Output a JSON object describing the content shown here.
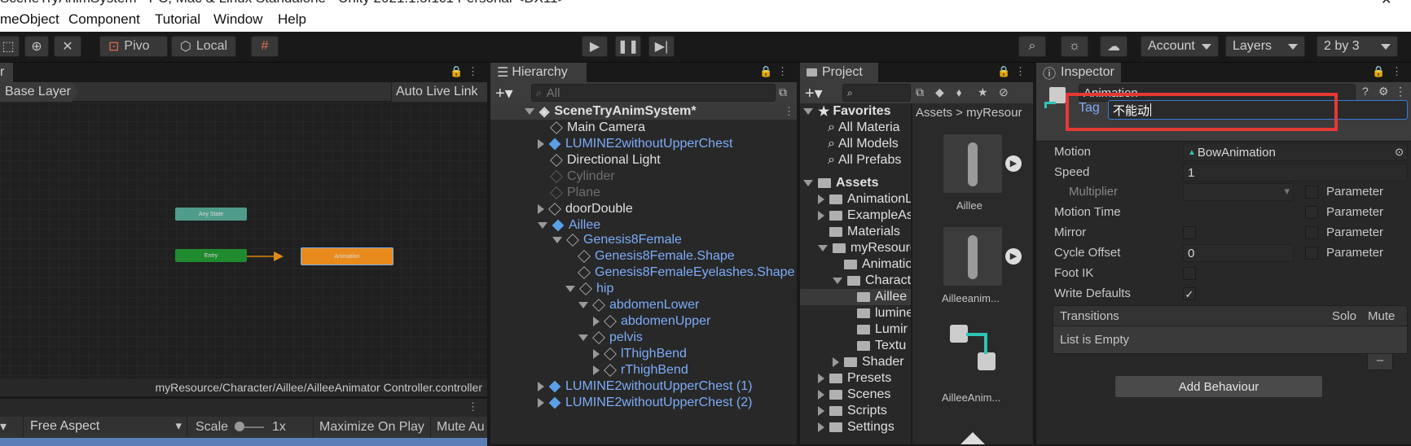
{
  "window": {
    "title": "SceneTryAnimSystem - PC, Mac & Linux Standalone - Unity 2021.1.5f1c1 Personal <DX11>"
  },
  "menu": [
    "meObject",
    "Component",
    "Tutorial",
    "Window",
    "Help"
  ],
  "toolbar": {
    "pivot_label": "Pivo",
    "local_label": "Local",
    "account_label": "Account",
    "layers_label": "Layers",
    "layout_label": "2 by 3"
  },
  "animator": {
    "breadcrumb": "Base Layer",
    "auto_live_link": "Auto Live Link",
    "path": "myResource/Character/Aillee/AilleeAnimator Controller.controller",
    "nodes": {
      "any_state": "Any State",
      "entry": "Entry",
      "animation": "Animation"
    }
  },
  "game": {
    "aspect": "Free Aspect",
    "scale_label": "Scale",
    "scale_value": "1x",
    "maximize": "Maximize On Play",
    "mute": "Mute Au"
  },
  "hierarchy": {
    "tab": "Hierarchy",
    "search_placeholder": "All",
    "scene": "SceneTryAnimSystem*",
    "items": [
      "Main Camera",
      "LUMINE2withoutUpperChest",
      "Directional Light",
      "Cylinder",
      "Plane",
      "doorDouble",
      "Aillee",
      "Genesis8Female",
      "Genesis8Female.Shape",
      "Genesis8FemaleEyelashes.Shape",
      "hip",
      "abdomenLower",
      "abdomenUpper",
      "pelvis",
      "lThighBend",
      "rThighBend",
      "LUMINE2withoutUpperChest (1)",
      "LUMINE2withoutUpperChest (2)"
    ]
  },
  "project": {
    "tab": "Project",
    "favorites": "Favorites",
    "fav_items": [
      "All Materia",
      "All Models",
      "All Prefabs"
    ],
    "assets": "Assets",
    "asset_items": [
      "AnimationL",
      "ExampleAs",
      "Materials",
      "myResourc",
      "Animatio",
      "Charact",
      "Aillee",
      "lumine",
      "Lumir",
      "Textu",
      "Shader",
      "Presets",
      "Scenes",
      "Scripts",
      "Settings"
    ],
    "breadcrumb": "Assets > myResour",
    "thumbs": [
      "Aillee",
      "Ailleeanim...",
      "AilleeAnim..."
    ]
  },
  "inspector": {
    "tab": "Inspector",
    "name_value": "Animation",
    "tag_label": "Tag",
    "tag_value": "不能动",
    "rows": {
      "motion": "Motion",
      "motion_value": "BowAnimation",
      "speed": "Speed",
      "speed_value": "1",
      "multiplier": "Multiplier",
      "motion_time": "Motion Time",
      "mirror": "Mirror",
      "cycle_offset": "Cycle Offset",
      "cycle_value": "0",
      "foot_ik": "Foot IK",
      "write_defaults": "Write Defaults",
      "parameter": "Parameter"
    },
    "transitions": "Transitions",
    "solo": "Solo",
    "mute": "Mute",
    "list_empty": "List is Empty",
    "add_behaviour": "Add Behaviour"
  },
  "colors": {
    "accent_red": "#e53935",
    "hier_blue": "#7cacf8",
    "anim_orange": "#e88a1c",
    "entry_green": "#1f8a2e",
    "any_state_teal": "#4f9c8a"
  }
}
